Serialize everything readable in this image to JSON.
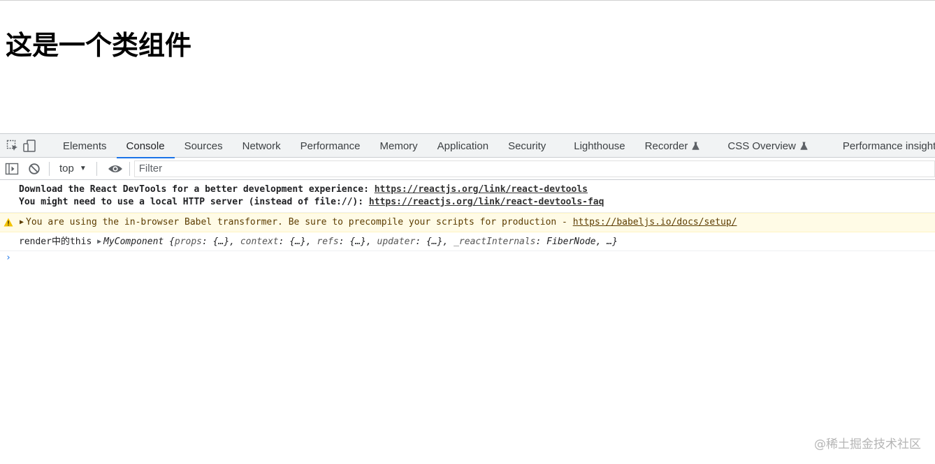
{
  "page": {
    "heading": "这是一个类组件"
  },
  "devtools": {
    "tabs": [
      {
        "label": "Elements"
      },
      {
        "label": "Console"
      },
      {
        "label": "Sources"
      },
      {
        "label": "Network"
      },
      {
        "label": "Performance"
      },
      {
        "label": "Memory"
      },
      {
        "label": "Application"
      },
      {
        "label": "Security"
      },
      {
        "label": "Lighthouse"
      },
      {
        "label": "Recorder"
      },
      {
        "label": "CSS Overview"
      },
      {
        "label": "Performance insights"
      }
    ],
    "active_tab": "Console",
    "toolbar": {
      "context": "top",
      "filter_placeholder": "Filter"
    },
    "console": {
      "devtools_msg": {
        "line1_text": "Download the React DevTools for a better development experience: ",
        "line1_link": "https://reactjs.org/link/react-devtools",
        "line2_text": "You might need to use a local HTTP server (instead of file://): ",
        "line2_link": "https://reactjs.org/link/react-devtools-faq"
      },
      "warning": {
        "text": "You are using the in-browser Babel transformer. Be sure to precompile your scripts for production - ",
        "link": "https://babeljs.io/docs/setup/"
      },
      "log": {
        "label": "render中的this ",
        "object_name": "MyComponent",
        "props_key": "props",
        "context_key": "context",
        "refs_key": "refs",
        "updater_key": "updater",
        "internals_key": "_reactInternals",
        "internals_value": "FiberNode",
        "collapsed": "{…}",
        "ellipsis": "…"
      },
      "prompt_symbol": "›"
    }
  },
  "watermark": "@稀土掘金技术社区",
  "colors": {
    "accent": "#1a73e8",
    "warning_bg": "#fffbe6",
    "warning_text": "#5c3c00"
  }
}
